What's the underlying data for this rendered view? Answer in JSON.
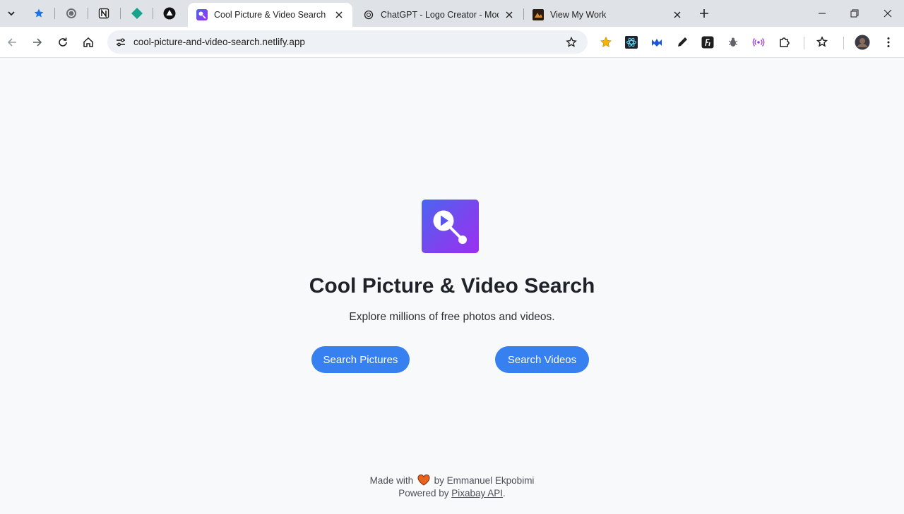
{
  "browser": {
    "tabs": [
      {
        "title": "Cool Picture & Video Search",
        "active": true
      },
      {
        "title": "ChatGPT - Logo Creator - Mode",
        "active": false
      },
      {
        "title": "View My Work",
        "active": false
      }
    ],
    "address": "cool-picture-and-video-search.netlify.app",
    "icons": {
      "tab_search": "chevron-down-icon",
      "pinned": [
        "bookmark-star-icon",
        "whatsapp-icon",
        "notion-icon",
        "diamond-icon",
        "triangle-logo-icon"
      ],
      "extensions": [
        "favorite-star-icon",
        "react-devtools-icon",
        "malwarebytes-icon",
        "eyedropper-icon",
        "font-icon",
        "bug-icon",
        "broadcast-icon",
        "puzzle-icon"
      ]
    }
  },
  "page": {
    "title": "Cool Picture & Video Search",
    "subtitle": "Explore millions of free photos and videos.",
    "buttons": {
      "pictures": "Search Pictures",
      "videos": "Search Videos"
    },
    "footer": {
      "made_with": "Made with",
      "by": "by Emmanuel Ekpobimi",
      "powered_by": "Powered by",
      "api_link": "Pixabay API",
      "period": "."
    }
  },
  "colors": {
    "accent": "#3680f0",
    "logo_gradient_start": "#4a65f1",
    "logo_gradient_end": "#9c2ff0",
    "heart": "#e8641c"
  }
}
